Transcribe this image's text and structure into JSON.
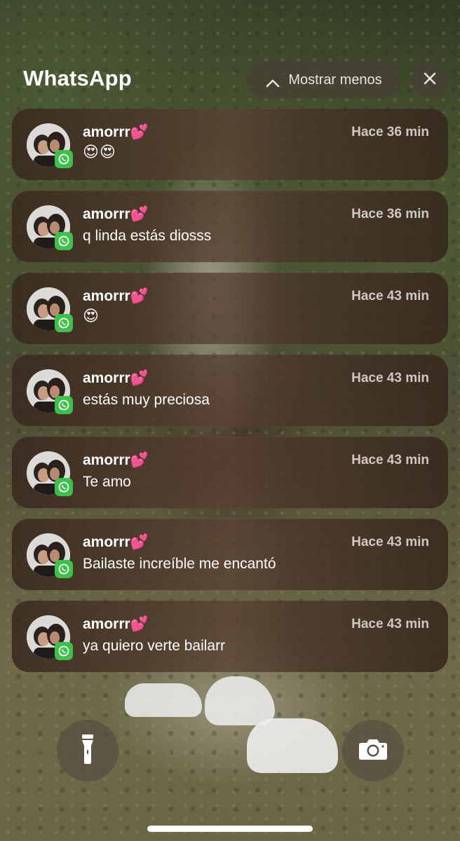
{
  "app": {
    "title": "WhatsApp"
  },
  "header": {
    "show_less_label": "Mostrar menos",
    "show_less_icon": "chevron-up-icon",
    "close_icon": "close-icon"
  },
  "colors": {
    "whatsapp_badge": "#3fbf4b",
    "card_bg": "#4b372b",
    "time_text": "#cfc8c2"
  },
  "notifications": [
    {
      "sender": "amorrr💕",
      "time": "Hace 36 min",
      "message": "😍😍"
    },
    {
      "sender": "amorrr💕",
      "time": "Hace 36 min",
      "message": "q linda estás diosss"
    },
    {
      "sender": "amorrr💕",
      "time": "Hace 43 min",
      "message": "😍"
    },
    {
      "sender": "amorrr💕",
      "time": "Hace 43 min",
      "message": "estás muy preciosa"
    },
    {
      "sender": "amorrr💕",
      "time": "Hace 43 min",
      "message": "Te amo"
    },
    {
      "sender": "amorrr💕",
      "time": "Hace 43 min",
      "message": "Bailaste increíble me encantó"
    },
    {
      "sender": "amorrr💕",
      "time": "Hace 43 min",
      "message": "ya quiero verte bailarr"
    }
  ],
  "controls": {
    "flashlight_icon": "flashlight-icon",
    "camera_icon": "camera-icon"
  }
}
